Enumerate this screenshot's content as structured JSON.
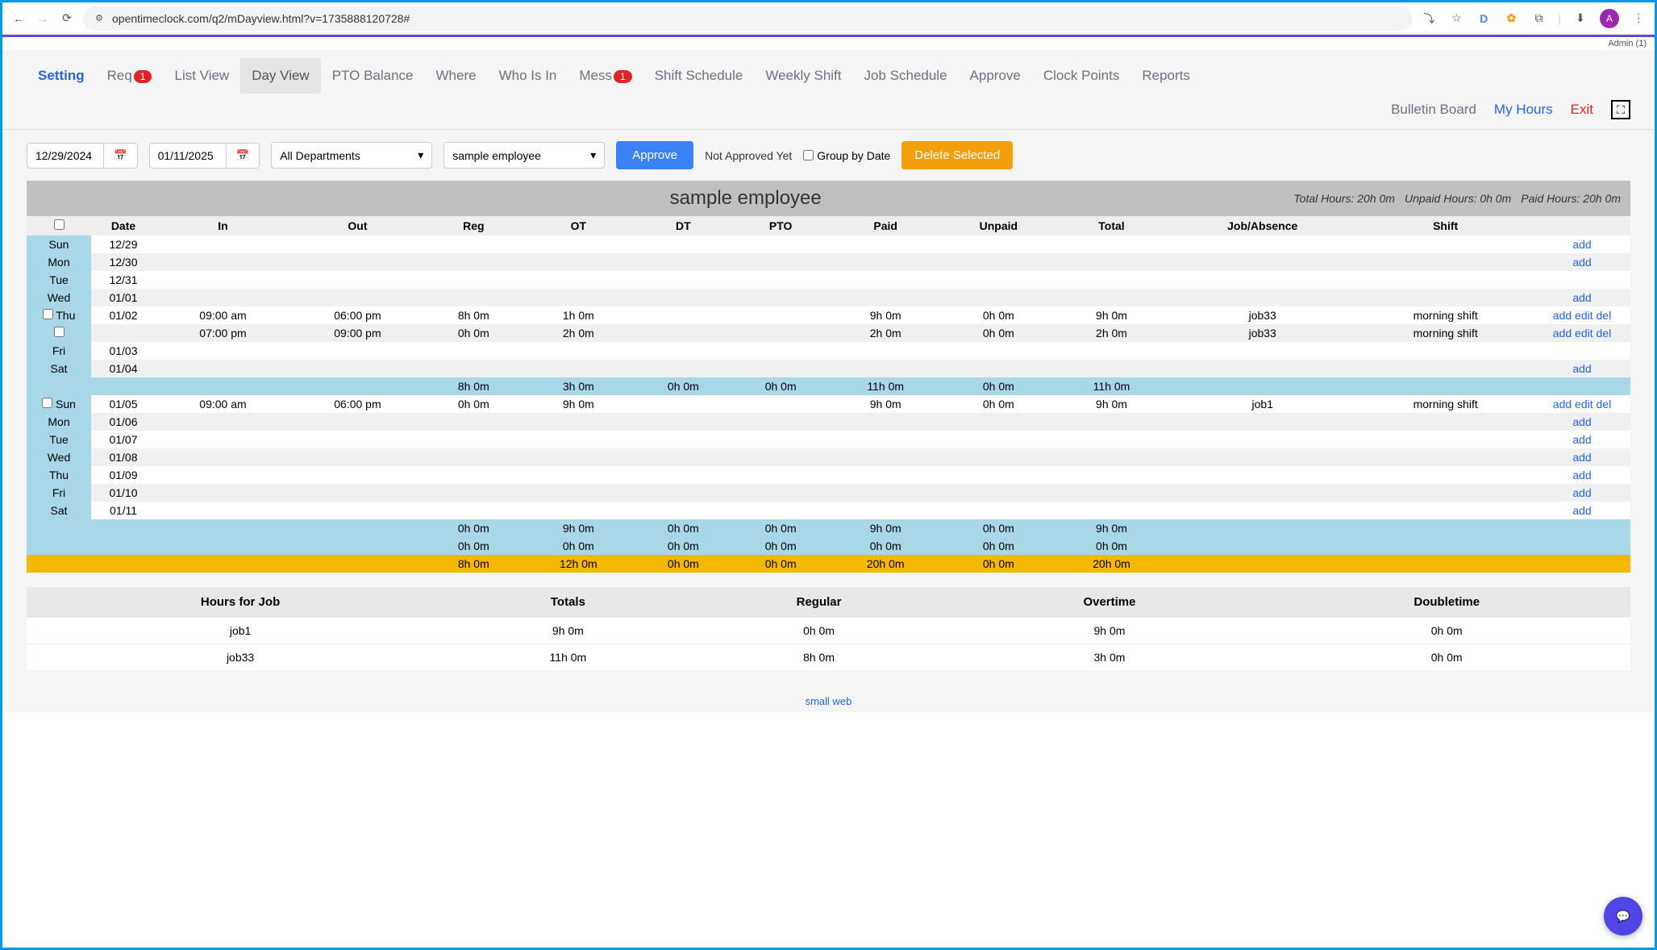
{
  "browser": {
    "url": "opentimeclock.com/q2/mDayview.html?v=1735888120728#",
    "avatar_letter": "A",
    "ext_d": "D"
  },
  "admin_label": "Admin (1)",
  "nav": {
    "setting": "Setting",
    "req": "Req",
    "req_badge": "1",
    "list_view": "List View",
    "day_view": "Day View",
    "pto_balance": "PTO Balance",
    "where": "Where",
    "who_is_in": "Who Is In",
    "mess": "Mess",
    "mess_badge": "1",
    "shift_schedule": "Shift Schedule",
    "weekly_shift": "Weekly Shift",
    "job_schedule": "Job Schedule",
    "approve": "Approve",
    "clock_points": "Clock Points",
    "reports": "Reports"
  },
  "subbar": {
    "bulletin": "Bulletin Board",
    "my_hours": "My Hours",
    "exit": "Exit"
  },
  "controls": {
    "date_from": "12/29/2024",
    "date_to": "01/11/2025",
    "department": "All Departments",
    "employee": "sample employee",
    "approve_btn": "Approve",
    "not_approved": "Not Approved Yet",
    "group_by_date": "Group by Date",
    "delete_selected": "Delete Selected"
  },
  "header": {
    "employee_name": "sample employee",
    "total_hours": "Total Hours: 20h 0m",
    "unpaid_hours": "Unpaid Hours: 0h 0m",
    "paid_hours": "Paid Hours: 20h 0m"
  },
  "columns": {
    "date": "Date",
    "in": "In",
    "out": "Out",
    "reg": "Reg",
    "ot": "OT",
    "dt": "DT",
    "pto": "PTO",
    "paid": "Paid",
    "unpaid": "Unpaid",
    "total": "Total",
    "job": "Job/Absence",
    "shift": "Shift"
  },
  "actions": {
    "add": "add",
    "edit": "edit",
    "del": "del"
  },
  "rows": {
    "r0": {
      "day": "Sun",
      "date": "12/29"
    },
    "r1": {
      "day": "Mon",
      "date": "12/30"
    },
    "r2": {
      "day": "Tue",
      "date": "12/31"
    },
    "r3": {
      "day": "Wed",
      "date": "01/01"
    },
    "r4": {
      "day": "Thu",
      "date": "01/02",
      "in": "09:00 am",
      "out": "06:00 pm",
      "reg": "8h 0m",
      "ot": "1h 0m",
      "paid": "9h 0m",
      "unpaid": "0h 0m",
      "total": "9h 0m",
      "job": "job33",
      "shift": "morning shift"
    },
    "r5": {
      "in": "07:00 pm",
      "out": "09:00 pm",
      "reg": "0h 0m",
      "ot": "2h 0m",
      "paid": "2h 0m",
      "unpaid": "0h 0m",
      "total": "2h 0m",
      "job": "job33",
      "shift": "morning shift"
    },
    "r6": {
      "day": "Fri",
      "date": "01/03"
    },
    "r7": {
      "day": "Sat",
      "date": "01/04"
    },
    "sub1": {
      "reg": "8h 0m",
      "ot": "3h 0m",
      "dt": "0h 0m",
      "pto": "0h 0m",
      "paid": "11h 0m",
      "unpaid": "0h 0m",
      "total": "11h 0m"
    },
    "r8": {
      "day": "Sun",
      "date": "01/05",
      "in": "09:00 am",
      "out": "06:00 pm",
      "reg": "0h 0m",
      "ot": "9h 0m",
      "paid": "9h 0m",
      "unpaid": "0h 0m",
      "total": "9h 0m",
      "job": "job1",
      "shift": "morning shift"
    },
    "r9": {
      "day": "Mon",
      "date": "01/06"
    },
    "r10": {
      "day": "Tue",
      "date": "01/07"
    },
    "r11": {
      "day": "Wed",
      "date": "01/08"
    },
    "r12": {
      "day": "Thu",
      "date": "01/09"
    },
    "r13": {
      "day": "Fri",
      "date": "01/10"
    },
    "r14": {
      "day": "Sat",
      "date": "01/11"
    },
    "sub2a": {
      "reg": "0h 0m",
      "ot": "9h 0m",
      "dt": "0h 0m",
      "pto": "0h 0m",
      "paid": "9h 0m",
      "unpaid": "0h 0m",
      "total": "9h 0m"
    },
    "sub2b": {
      "reg": "0h 0m",
      "ot": "0h 0m",
      "dt": "0h 0m",
      "pto": "0h 0m",
      "paid": "0h 0m",
      "unpaid": "0h 0m",
      "total": "0h 0m"
    },
    "grand": {
      "reg": "8h 0m",
      "ot": "12h 0m",
      "dt": "0h 0m",
      "pto": "0h 0m",
      "paid": "20h 0m",
      "unpaid": "0h 0m",
      "total": "20h 0m"
    }
  },
  "summary": {
    "cols": {
      "hours_for_job": "Hours for Job",
      "totals": "Totals",
      "regular": "Regular",
      "overtime": "Overtime",
      "doubletime": "Doubletime"
    },
    "r0": {
      "job": "job1",
      "totals": "9h 0m",
      "regular": "0h 0m",
      "overtime": "9h 0m",
      "doubletime": "0h 0m"
    },
    "r1": {
      "job": "job33",
      "totals": "11h 0m",
      "regular": "8h 0m",
      "overtime": "3h 0m",
      "doubletime": "0h 0m"
    }
  },
  "footer_link": "small web"
}
